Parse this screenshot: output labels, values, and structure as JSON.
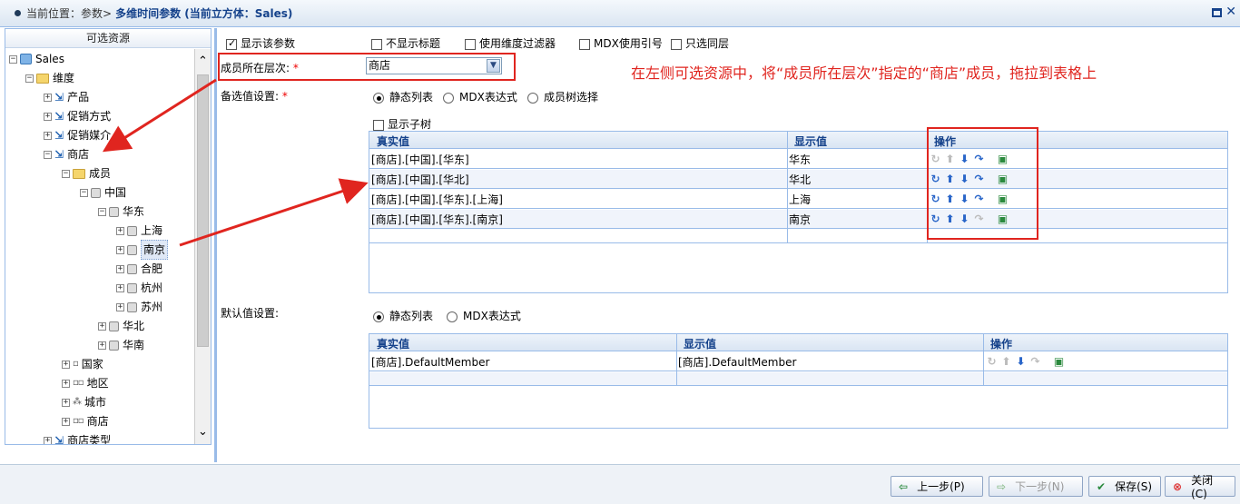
{
  "titlebar": {
    "location_label": "当前位置：参数>",
    "title": "多维时间参数 (当前立方体：Sales)"
  },
  "left_panel": {
    "header": "可选资源",
    "tree": {
      "root": "Sales",
      "dimension_folder": "维度",
      "product": "产品",
      "promotion": "促销方式",
      "promo_media": "促销媒介",
      "store": "商店",
      "members": "成员",
      "china": "中国",
      "east": "华东",
      "shanghai": "上海",
      "nanjing": "南京",
      "hefei": "合肥",
      "hangzhou": "杭州",
      "suzhou": "苏州",
      "north": "华北",
      "south": "华南",
      "country": "国家",
      "region": "地区",
      "city": "城市",
      "store_level": "商店",
      "store_type": "商店类型"
    }
  },
  "options": {
    "show_param": "显示该参数",
    "hide_title": "不显示标题",
    "use_dim_filter": "使用维度过滤器",
    "mdx_quote": "MDX使用引号",
    "single_select": "只选同层"
  },
  "member_level": {
    "label": "成员所在层次:",
    "required": "*",
    "value": "商店"
  },
  "annotation": "在左侧可选资源中，将“成员所在层次”指定的“商店”成员，拖拉到表格上",
  "candidate": {
    "label": "备选值设置:",
    "required": "*",
    "static_list": "静态列表",
    "mdx_expr": "MDX表达式",
    "member_tree": "成员树选择",
    "show_subtree": "显示子树",
    "columns": {
      "real": "真实值",
      "display": "显示值",
      "ops": "操作"
    },
    "rows": [
      {
        "real": "[商店].[中国].[华东]",
        "display": "华东"
      },
      {
        "real": "[商店].[中国].[华北]",
        "display": "华北"
      },
      {
        "real": "[商店].[中国].[华东].[上海]",
        "display": "上海"
      },
      {
        "real": "[商店].[中国].[华东].[南京]",
        "display": "南京"
      }
    ]
  },
  "default": {
    "label": "默认值设置:",
    "static_list": "静态列表",
    "mdx_expr": "MDX表达式",
    "columns": {
      "real": "真实值",
      "display": "显示值",
      "ops": "操作"
    },
    "rows": [
      {
        "real": "[商店].DefaultMember",
        "display": "[商店].DefaultMember"
      }
    ]
  },
  "buttons": {
    "prev": "上一步(P)",
    "next": "下一步(N)",
    "save": "保存(S)",
    "close": "关闭(C)"
  },
  "colors": {
    "annotation_red": "#e0251f",
    "header_blue": "#15428b",
    "border_blue": "#99bbe8"
  }
}
